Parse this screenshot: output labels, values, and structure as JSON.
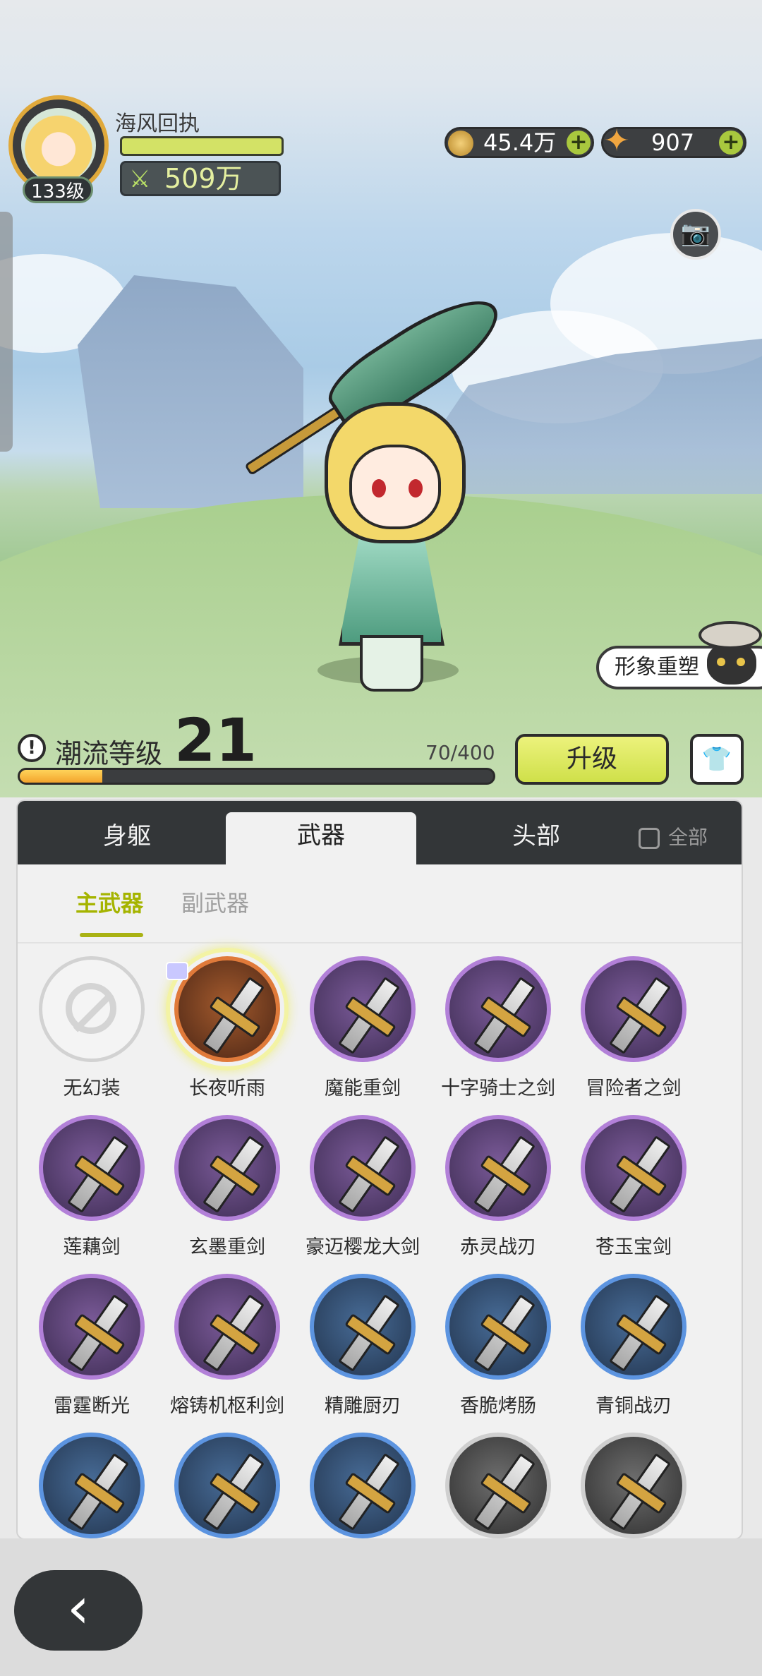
{
  "player": {
    "name": "海风回执",
    "level": "133级",
    "power": "509万"
  },
  "currencies": [
    {
      "icon": "gold-coin-icon",
      "value": "45.4万"
    },
    {
      "icon": "star-crystal-icon",
      "value": "907"
    }
  ],
  "reshape_label": "形象重塑",
  "trend": {
    "label": "潮流等级",
    "level": "21",
    "progress_text": "70/400",
    "progress_fraction": 0.175,
    "upgrade_label": "升级"
  },
  "tabs": {
    "body": "身躯",
    "weapon": "武器",
    "head": "头部",
    "show_all": "全部"
  },
  "subtabs": {
    "main": "主武器",
    "secondary": "副武器"
  },
  "items": [
    {
      "name": "无幻装",
      "rarity": "none"
    },
    {
      "name": "长夜听雨",
      "rarity": "orange",
      "selected": true
    },
    {
      "name": "魔能重剑",
      "rarity": "purple"
    },
    {
      "name": "十字骑士之剑",
      "rarity": "purple"
    },
    {
      "name": "冒险者之剑",
      "rarity": "purple"
    },
    {
      "name": "莲藕剑",
      "rarity": "purple"
    },
    {
      "name": "玄墨重剑",
      "rarity": "purple"
    },
    {
      "name": "豪迈樱龙大剑",
      "rarity": "purple"
    },
    {
      "name": "赤灵战刃",
      "rarity": "purple"
    },
    {
      "name": "苍玉宝剑",
      "rarity": "purple"
    },
    {
      "name": "雷霆断光",
      "rarity": "purple"
    },
    {
      "name": "熔铸机枢利剑",
      "rarity": "purple"
    },
    {
      "name": "精雕厨刃",
      "rarity": "blue"
    },
    {
      "name": "香脆烤肠",
      "rarity": "blue"
    },
    {
      "name": "青铜战刃",
      "rarity": "blue"
    },
    {
      "name": "",
      "rarity": "blue"
    },
    {
      "name": "",
      "rarity": "blue"
    },
    {
      "name": "",
      "rarity": "blue"
    },
    {
      "name": "",
      "rarity": "gray"
    },
    {
      "name": "",
      "rarity": "gray"
    }
  ],
  "colors": {
    "accent_green": "#a5b400",
    "upgrade_yellow": "#dfe95c",
    "dark_panel": "#333638",
    "purple_rarity": "#b280d8",
    "blue_rarity": "#5c94e0"
  }
}
